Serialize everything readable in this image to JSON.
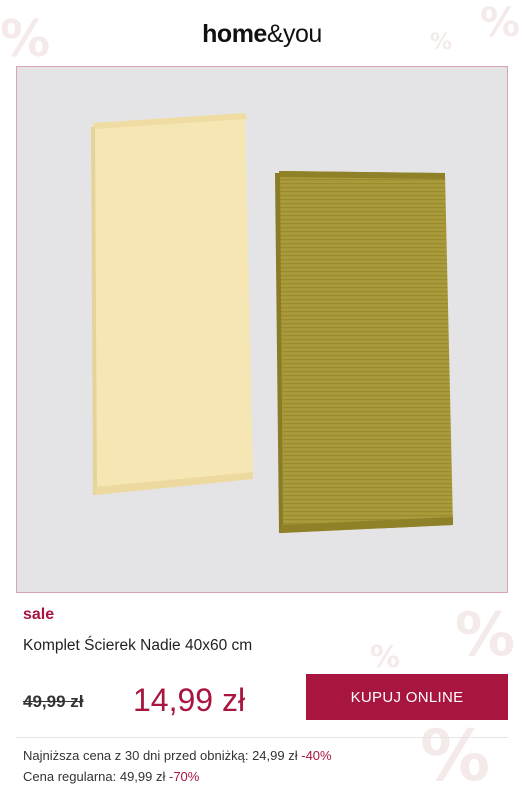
{
  "brand": {
    "bold": "home",
    "light": "&you"
  },
  "product": {
    "badge": "sale",
    "title": "Komplet Ścierek Nadie 40x60 cm",
    "old_price": "49,99 zł",
    "price": "14,99 zł"
  },
  "cta": {
    "label": "KUPUJ ONLINE"
  },
  "info": {
    "lowest_label": "Najniższa cena z 30 dni przed obniżką: 24,99 zł",
    "lowest_discount": "-40%",
    "regular_label": "Cena regularna: 49,99 zł",
    "regular_discount": "-70%"
  },
  "colors": {
    "accent": "#a8153f",
    "towel_cream": "#f5e6b4",
    "towel_olive": "#a99a3a",
    "photo_bg": "#e4e4e6"
  },
  "background_decor": "percent-symbol"
}
